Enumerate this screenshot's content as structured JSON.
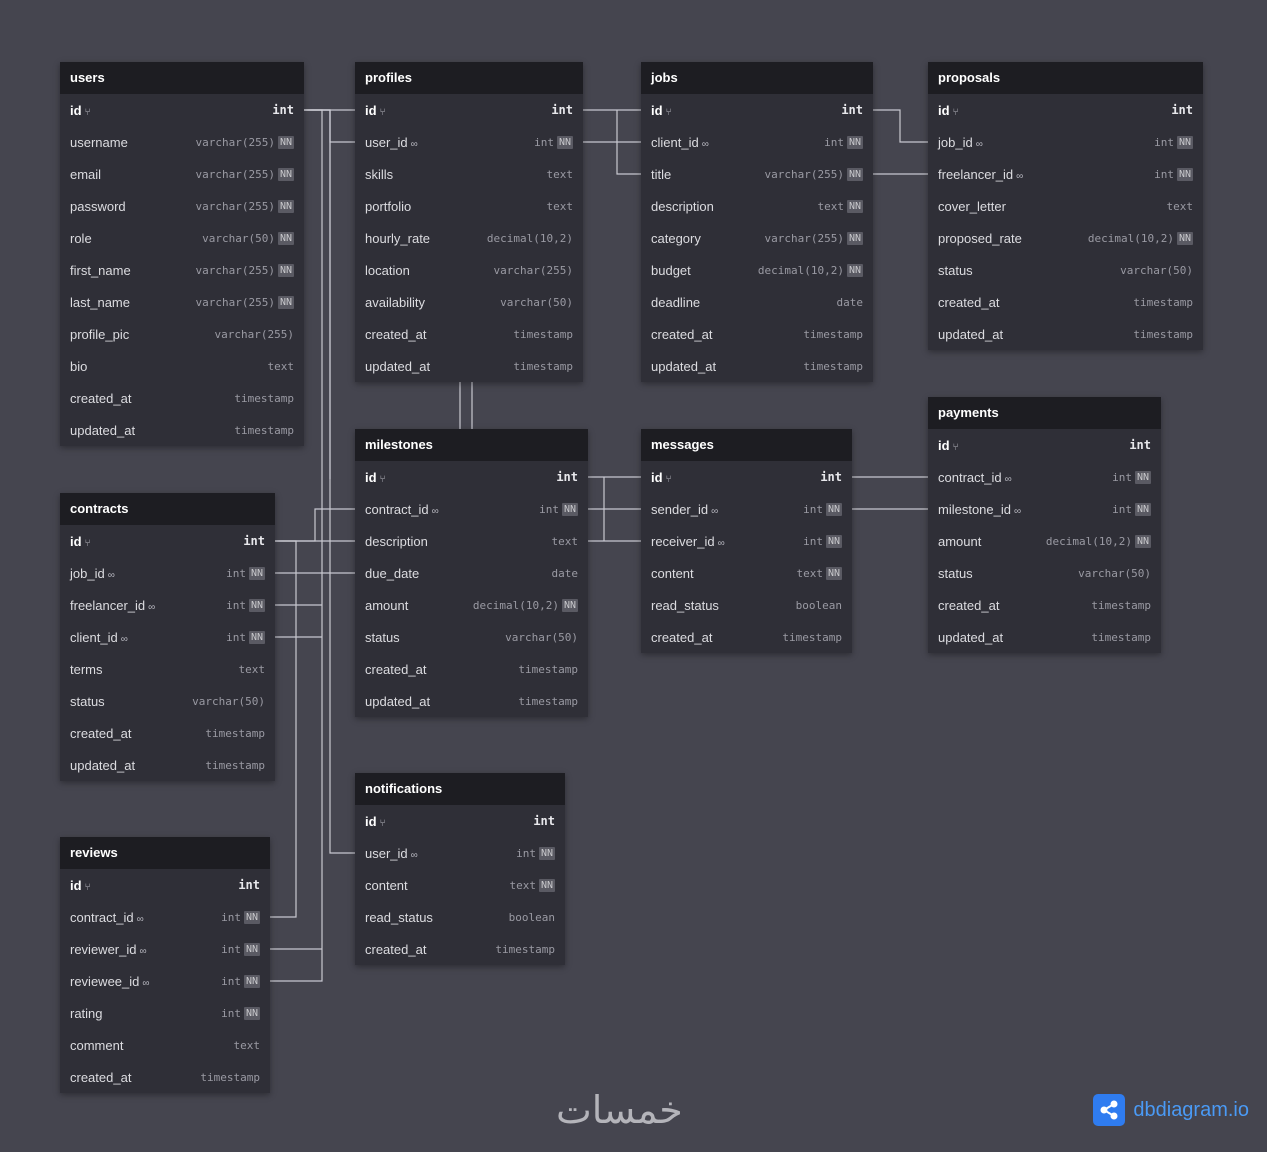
{
  "tables": [
    {
      "name": "users",
      "fields": [
        {
          "name": "id",
          "type": "int",
          "pk": true
        },
        {
          "name": "username",
          "type": "varchar(255)",
          "nn": true
        },
        {
          "name": "email",
          "type": "varchar(255)",
          "nn": true
        },
        {
          "name": "password",
          "type": "varchar(255)",
          "nn": true
        },
        {
          "name": "role",
          "type": "varchar(50)",
          "nn": true
        },
        {
          "name": "first_name",
          "type": "varchar(255)",
          "nn": true
        },
        {
          "name": "last_name",
          "type": "varchar(255)",
          "nn": true
        },
        {
          "name": "profile_pic",
          "type": "varchar(255)"
        },
        {
          "name": "bio",
          "type": "text"
        },
        {
          "name": "created_at",
          "type": "timestamp"
        },
        {
          "name": "updated_at",
          "type": "timestamp"
        }
      ]
    },
    {
      "name": "profiles",
      "fields": [
        {
          "name": "id",
          "type": "int",
          "pk": true
        },
        {
          "name": "user_id",
          "type": "int",
          "nn": true,
          "fk": true
        },
        {
          "name": "skills",
          "type": "text"
        },
        {
          "name": "portfolio",
          "type": "text"
        },
        {
          "name": "hourly_rate",
          "type": "decimal(10,2)"
        },
        {
          "name": "location",
          "type": "varchar(255)"
        },
        {
          "name": "availability",
          "type": "varchar(50)"
        },
        {
          "name": "created_at",
          "type": "timestamp"
        },
        {
          "name": "updated_at",
          "type": "timestamp"
        }
      ]
    },
    {
      "name": "jobs",
      "fields": [
        {
          "name": "id",
          "type": "int",
          "pk": true
        },
        {
          "name": "client_id",
          "type": "int",
          "nn": true,
          "fk": true
        },
        {
          "name": "title",
          "type": "varchar(255)",
          "nn": true
        },
        {
          "name": "description",
          "type": "text",
          "nn": true
        },
        {
          "name": "category",
          "type": "varchar(255)",
          "nn": true
        },
        {
          "name": "budget",
          "type": "decimal(10,2)",
          "nn": true
        },
        {
          "name": "deadline",
          "type": "date"
        },
        {
          "name": "created_at",
          "type": "timestamp"
        },
        {
          "name": "updated_at",
          "type": "timestamp"
        }
      ]
    },
    {
      "name": "proposals",
      "fields": [
        {
          "name": "id",
          "type": "int",
          "pk": true
        },
        {
          "name": "job_id",
          "type": "int",
          "nn": true,
          "fk": true
        },
        {
          "name": "freelancer_id",
          "type": "int",
          "nn": true,
          "fk": true
        },
        {
          "name": "cover_letter",
          "type": "text"
        },
        {
          "name": "proposed_rate",
          "type": "decimal(10,2)",
          "nn": true
        },
        {
          "name": "status",
          "type": "varchar(50)"
        },
        {
          "name": "created_at",
          "type": "timestamp"
        },
        {
          "name": "updated_at",
          "type": "timestamp"
        }
      ]
    },
    {
      "name": "contracts",
      "fields": [
        {
          "name": "id",
          "type": "int",
          "pk": true
        },
        {
          "name": "job_id",
          "type": "int",
          "nn": true,
          "fk": true
        },
        {
          "name": "freelancer_id",
          "type": "int",
          "nn": true,
          "fk": true
        },
        {
          "name": "client_id",
          "type": "int",
          "nn": true,
          "fk": true
        },
        {
          "name": "terms",
          "type": "text"
        },
        {
          "name": "status",
          "type": "varchar(50)"
        },
        {
          "name": "created_at",
          "type": "timestamp"
        },
        {
          "name": "updated_at",
          "type": "timestamp"
        }
      ]
    },
    {
      "name": "milestones",
      "fields": [
        {
          "name": "id",
          "type": "int",
          "pk": true
        },
        {
          "name": "contract_id",
          "type": "int",
          "nn": true,
          "fk": true
        },
        {
          "name": "description",
          "type": "text"
        },
        {
          "name": "due_date",
          "type": "date"
        },
        {
          "name": "amount",
          "type": "decimal(10,2)",
          "nn": true
        },
        {
          "name": "status",
          "type": "varchar(50)"
        },
        {
          "name": "created_at",
          "type": "timestamp"
        },
        {
          "name": "updated_at",
          "type": "timestamp"
        }
      ]
    },
    {
      "name": "messages",
      "fields": [
        {
          "name": "id",
          "type": "int",
          "pk": true
        },
        {
          "name": "sender_id",
          "type": "int",
          "nn": true,
          "fk": true
        },
        {
          "name": "receiver_id",
          "type": "int",
          "nn": true,
          "fk": true
        },
        {
          "name": "content",
          "type": "text",
          "nn": true
        },
        {
          "name": "read_status",
          "type": "boolean"
        },
        {
          "name": "created_at",
          "type": "timestamp"
        }
      ]
    },
    {
      "name": "payments",
      "fields": [
        {
          "name": "id",
          "type": "int",
          "pk": true
        },
        {
          "name": "contract_id",
          "type": "int",
          "nn": true,
          "fk": true
        },
        {
          "name": "milestone_id",
          "type": "int",
          "nn": true,
          "fk": true
        },
        {
          "name": "amount",
          "type": "decimal(10,2)",
          "nn": true
        },
        {
          "name": "status",
          "type": "varchar(50)"
        },
        {
          "name": "created_at",
          "type": "timestamp"
        },
        {
          "name": "updated_at",
          "type": "timestamp"
        }
      ]
    },
    {
      "name": "reviews",
      "fields": [
        {
          "name": "id",
          "type": "int",
          "pk": true
        },
        {
          "name": "contract_id",
          "type": "int",
          "nn": true,
          "fk": true
        },
        {
          "name": "reviewer_id",
          "type": "int",
          "nn": true,
          "fk": true
        },
        {
          "name": "reviewee_id",
          "type": "int",
          "nn": true,
          "fk": true
        },
        {
          "name": "rating",
          "type": "int",
          "nn": true
        },
        {
          "name": "comment",
          "type": "text"
        },
        {
          "name": "created_at",
          "type": "timestamp"
        }
      ]
    },
    {
      "name": "notifications",
      "fields": [
        {
          "name": "id",
          "type": "int",
          "pk": true
        },
        {
          "name": "user_id",
          "type": "int",
          "nn": true,
          "fk": true
        },
        {
          "name": "content",
          "type": "text",
          "nn": true
        },
        {
          "name": "read_status",
          "type": "boolean"
        },
        {
          "name": "created_at",
          "type": "timestamp"
        }
      ]
    }
  ],
  "labels": {
    "nn": "NN",
    "pk_icon": "key-icon",
    "fk_icon": "link-icon"
  },
  "branding": {
    "watermark": "خمسات",
    "logo_text": "dbdiagram.io"
  },
  "colors": {
    "background": "#45454f",
    "header": "#1d1d22",
    "body": "#2f2f37",
    "line": "#c8c8d0",
    "logo": "#2f7cf0"
  }
}
